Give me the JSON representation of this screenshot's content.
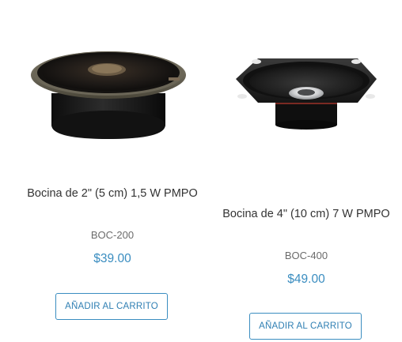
{
  "products": [
    {
      "title": "Bocina de 2\" (5 cm) 1,5 W PMPO",
      "sku": "BOC-200",
      "price": "$39.00",
      "button_label": "AÑADIR AL CARRITO",
      "image_icon": "speaker-2in-icon"
    },
    {
      "title": "Bocina de 4\" (10 cm) 7 W PMPO",
      "sku": "BOC-400",
      "price": "$49.00",
      "button_label": "AÑADIR AL CARRITO",
      "image_icon": "speaker-4in-icon"
    }
  ],
  "colors": {
    "accent": "#3a8dc0",
    "title_text": "#333333",
    "sku_text": "#6b6b6b"
  }
}
